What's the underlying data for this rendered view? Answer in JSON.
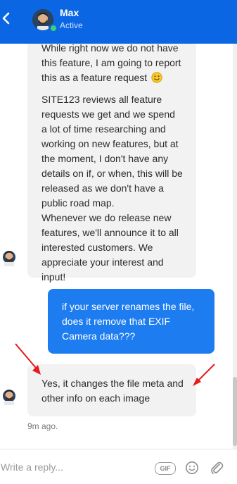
{
  "header": {
    "name": "Max",
    "status": "Active",
    "accent": "#0b66e4"
  },
  "messages": {
    "msg1": {
      "line1": "While right now we do not have",
      "line2": "this feature, I am going to report",
      "line3": "this as a feature request",
      "emoji": "smiley-face-icon",
      "para2": [
        "SITE123 reviews all feature",
        "requests we get and we spend",
        "a lot of time researching and",
        "working on new features, but at",
        "the moment, I don't have any",
        "details on if, or when, this will be",
        "released as we don't have a",
        "public road map.",
        "Whenever we do release new",
        "features, we'll announce it to all",
        "interested customers. We",
        "appreciate your interest and",
        "input!"
      ]
    },
    "msg2": [
      "if your server renames the file,",
      "does it remove that EXIF",
      "Camera data???"
    ],
    "msg3": [
      "Yes, it changes the file meta and",
      "other info on each image"
    ],
    "time": "9m ago."
  },
  "composer": {
    "placeholder": "Write a reply...",
    "gif_label": "GIF",
    "icons": [
      "gif-icon",
      "emoji-icon",
      "attach-icon"
    ]
  },
  "colors": {
    "outgoing_bubble": "#1d7cf0",
    "incoming_bubble": "#f2f2f2",
    "annotation_arrow": "#e41d1d"
  }
}
